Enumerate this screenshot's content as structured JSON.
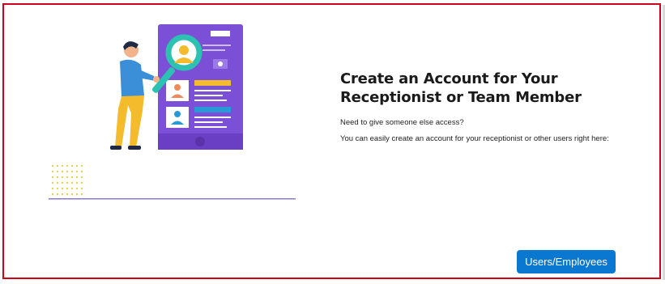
{
  "panel": {
    "title": "Create an Account for Your Receptionist or Team Member",
    "subtitle": "Need to give someone else access?",
    "description": "You can easily create an account for your receptionist or other users right here:"
  },
  "actions": {
    "users_button_label": "Users/Employees"
  },
  "colors": {
    "frame_border": "#d0021b",
    "button_bg": "#0a78d1",
    "phone_purple": "#7b4fd6",
    "accent_teal": "#2cc1b0",
    "accent_yellow": "#f4bc2c"
  },
  "icons": {
    "illustration": "person-with-magnifier-on-profile-phone"
  }
}
